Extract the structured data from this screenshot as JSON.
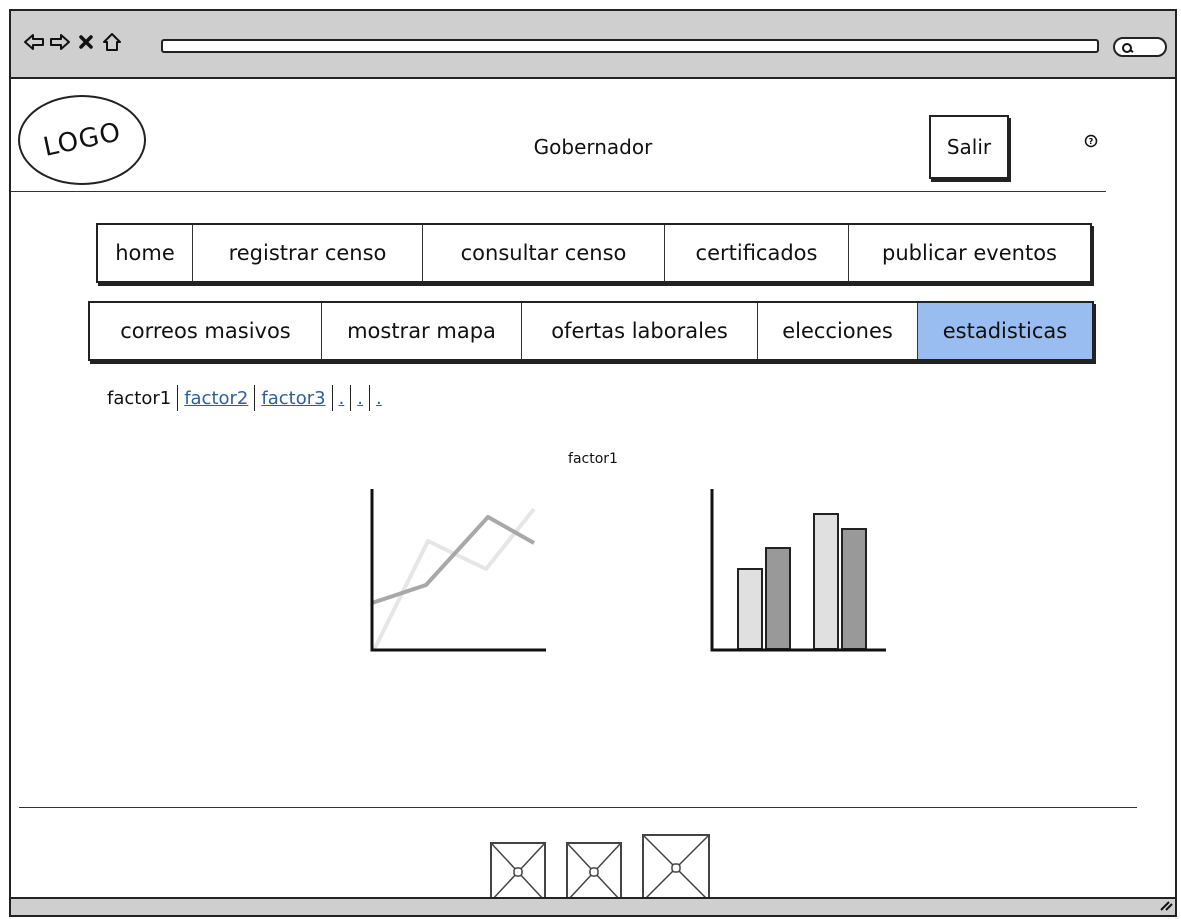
{
  "header": {
    "logo_text": "LOGO",
    "title": "Gobernador",
    "salir_label": "Salir"
  },
  "menu": {
    "row1": [
      {
        "label": "home"
      },
      {
        "label": "registrar censo"
      },
      {
        "label": "consultar censo"
      },
      {
        "label": "certificados"
      },
      {
        "label": "publicar eventos"
      }
    ],
    "row2": [
      {
        "label": "correos masivos"
      },
      {
        "label": "mostrar mapa"
      },
      {
        "label": "ofertas laborales"
      },
      {
        "label": "elecciones"
      },
      {
        "label": "estadisticas",
        "active": true
      }
    ]
  },
  "factor_tabs": [
    {
      "label": "factor1",
      "selected": true
    },
    {
      "label": "factor2"
    },
    {
      "label": "factor3"
    },
    {
      "label": "."
    },
    {
      "label": "."
    },
    {
      "label": "."
    }
  ],
  "main": {
    "chart_title": "factor1"
  },
  "colors": {
    "active_tab": "#99bdf0",
    "link": "#2c5f9e",
    "browser_chrome": "#cfcfcf"
  }
}
